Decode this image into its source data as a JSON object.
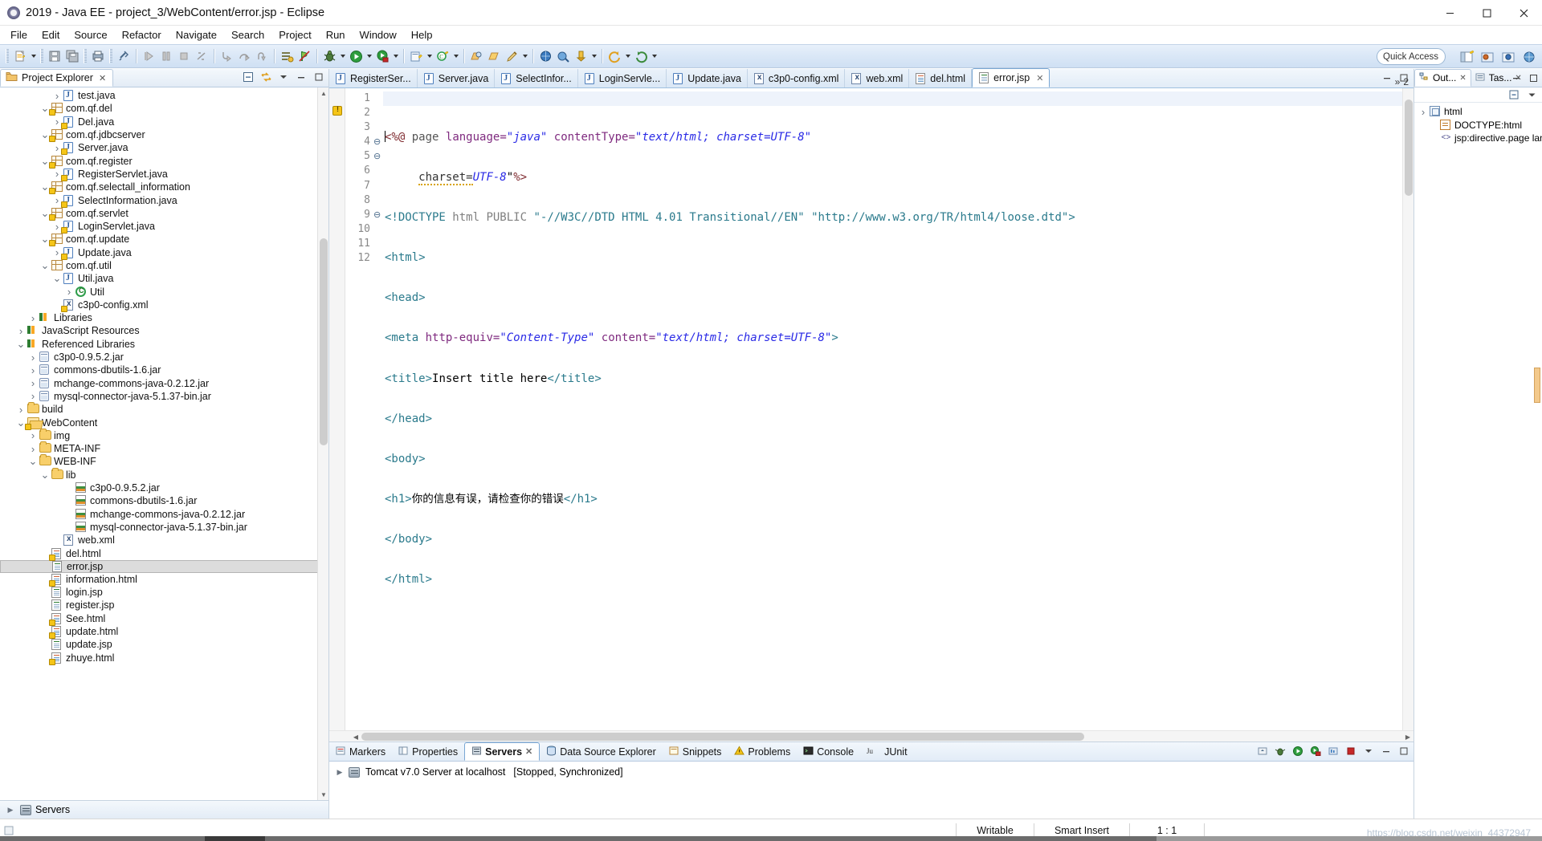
{
  "window": {
    "title": "2019 - Java EE - project_3/WebContent/error.jsp - Eclipse",
    "app_icon": "eclipse-icon",
    "minimize": "minimize-button",
    "maximize": "maximize-button",
    "close": "close-button"
  },
  "menubar": {
    "items": [
      "File",
      "Edit",
      "Source",
      "Refactor",
      "Navigate",
      "Search",
      "Project",
      "Run",
      "Window",
      "Help"
    ]
  },
  "toolbar": {
    "quick_access_placeholder": "Quick Access",
    "icons": [
      "new-wizard-icon",
      "save-icon",
      "save-all-icon",
      "print-icon",
      "link-icon",
      "resume-icon",
      "suspend-icon",
      "terminate-icon",
      "step-icon",
      "step-into-icon",
      "step-over-icon",
      "step-return-icon",
      "open-task-icon",
      "skip-breakpoints-icon",
      "debug-icon",
      "run-icon",
      "run-server-icon",
      "new-java-project-icon",
      "new-class-icon",
      "new-annotation-icon",
      "open-type-icon",
      "search-icon",
      "next-annotation-icon",
      "previous-annotation-icon",
      "last-edit-icon",
      "back-icon",
      "forward-icon"
    ],
    "perspective_icons": [
      "open-perspective-icon",
      "java-ee-perspective-icon",
      "java-perspective-icon",
      "web-perspective-icon"
    ]
  },
  "project_explorer": {
    "tab_label": "Project Explorer",
    "tab_icon": "project-explorer-icon",
    "actions": [
      "collapse-all-icon",
      "link-with-editor-icon",
      "view-menu-icon",
      "minimize-icon",
      "maximize-icon"
    ],
    "tree": [
      {
        "label": "test.java",
        "indent": 4,
        "icon": "java-file-icon",
        "twist": "collapsed",
        "warn": false
      },
      {
        "label": "com.qf.del",
        "indent": 3,
        "icon": "package-icon",
        "twist": "expanded",
        "warn": true
      },
      {
        "label": "Del.java",
        "indent": 4,
        "icon": "java-file-icon",
        "twist": "collapsed",
        "warn": true
      },
      {
        "label": "com.qf.jdbcserver",
        "indent": 3,
        "icon": "package-icon",
        "twist": "expanded",
        "warn": true
      },
      {
        "label": "Server.java",
        "indent": 4,
        "icon": "java-file-icon",
        "twist": "collapsed",
        "warn": true
      },
      {
        "label": "com.qf.register",
        "indent": 3,
        "icon": "package-icon",
        "twist": "expanded",
        "warn": true
      },
      {
        "label": "RegisterServlet.java",
        "indent": 4,
        "icon": "java-file-icon",
        "twist": "collapsed",
        "warn": true
      },
      {
        "label": "com.qf.selectall_information",
        "indent": 3,
        "icon": "package-icon",
        "twist": "expanded",
        "warn": true
      },
      {
        "label": "SelectInformation.java",
        "indent": 4,
        "icon": "java-file-icon",
        "twist": "collapsed",
        "warn": true
      },
      {
        "label": "com.qf.servlet",
        "indent": 3,
        "icon": "package-icon",
        "twist": "expanded",
        "warn": true
      },
      {
        "label": "LoginServlet.java",
        "indent": 4,
        "icon": "java-file-icon",
        "twist": "collapsed",
        "warn": true
      },
      {
        "label": "com.qf.update",
        "indent": 3,
        "icon": "package-icon",
        "twist": "expanded",
        "warn": true
      },
      {
        "label": "Update.java",
        "indent": 4,
        "icon": "java-file-icon",
        "twist": "collapsed",
        "warn": true
      },
      {
        "label": "com.qf.util",
        "indent": 3,
        "icon": "package-icon",
        "twist": "expanded",
        "warn": false
      },
      {
        "label": "Util.java",
        "indent": 4,
        "icon": "java-file-icon",
        "twist": "expanded",
        "warn": false
      },
      {
        "label": "Util",
        "indent": 5,
        "icon": "class-icon",
        "twist": "collapsed",
        "warn": false
      },
      {
        "label": "c3p0-config.xml",
        "indent": 4,
        "icon": "xml-file-icon",
        "twist": "none",
        "warn": true
      },
      {
        "label": "Libraries",
        "indent": 2,
        "icon": "library-icon",
        "twist": "collapsed",
        "warn": false
      },
      {
        "label": "JavaScript Resources",
        "indent": 1,
        "icon": "library-icon",
        "twist": "collapsed",
        "warn": false
      },
      {
        "label": "Referenced Libraries",
        "indent": 1,
        "icon": "library-icon",
        "twist": "expanded",
        "warn": false
      },
      {
        "label": "c3p0-0.9.5.2.jar",
        "indent": 2,
        "icon": "jar-icon",
        "twist": "collapsed",
        "warn": false
      },
      {
        "label": "commons-dbutils-1.6.jar",
        "indent": 2,
        "icon": "jar-icon",
        "twist": "collapsed",
        "warn": false
      },
      {
        "label": "mchange-commons-java-0.2.12.jar",
        "indent": 2,
        "icon": "jar-icon",
        "twist": "collapsed",
        "warn": false
      },
      {
        "label": "mysql-connector-java-5.1.37-bin.jar",
        "indent": 2,
        "icon": "jar-icon",
        "twist": "collapsed",
        "warn": false
      },
      {
        "label": "build",
        "indent": 1,
        "icon": "folder-icon",
        "twist": "collapsed",
        "warn": false
      },
      {
        "label": "WebContent",
        "indent": 1,
        "icon": "folder-open-icon",
        "twist": "expanded",
        "warn": true
      },
      {
        "label": "img",
        "indent": 2,
        "icon": "folder-icon",
        "twist": "collapsed",
        "warn": false
      },
      {
        "label": "META-INF",
        "indent": 2,
        "icon": "folder-icon",
        "twist": "collapsed",
        "warn": false
      },
      {
        "label": "WEB-INF",
        "indent": 2,
        "icon": "folder-icon",
        "twist": "expanded",
        "warn": false
      },
      {
        "label": "lib",
        "indent": 3,
        "icon": "folder-icon",
        "twist": "expanded",
        "warn": false
      },
      {
        "label": "c3p0-0.9.5.2.jar",
        "indent": 5,
        "icon": "jar-archive-icon",
        "twist": "none",
        "warn": false
      },
      {
        "label": "commons-dbutils-1.6.jar",
        "indent": 5,
        "icon": "jar-archive-icon",
        "twist": "none",
        "warn": false
      },
      {
        "label": "mchange-commons-java-0.2.12.jar",
        "indent": 5,
        "icon": "jar-archive-icon",
        "twist": "none",
        "warn": false
      },
      {
        "label": "mysql-connector-java-5.1.37-bin.jar",
        "indent": 5,
        "icon": "jar-archive-icon",
        "twist": "none",
        "warn": false
      },
      {
        "label": "web.xml",
        "indent": 4,
        "icon": "xml-file-icon",
        "twist": "none",
        "warn": false
      },
      {
        "label": "del.html",
        "indent": 3,
        "icon": "html-file-icon",
        "twist": "none",
        "warn": true
      },
      {
        "label": "error.jsp",
        "indent": 3,
        "icon": "jsp-file-icon",
        "twist": "none",
        "warn": false,
        "selected": true
      },
      {
        "label": "information.html",
        "indent": 3,
        "icon": "html-file-icon",
        "twist": "none",
        "warn": true
      },
      {
        "label": "login.jsp",
        "indent": 3,
        "icon": "jsp-file-icon",
        "twist": "none",
        "warn": false
      },
      {
        "label": "register.jsp",
        "indent": 3,
        "icon": "jsp-file-icon",
        "twist": "none",
        "warn": false
      },
      {
        "label": "See.html",
        "indent": 3,
        "icon": "html-file-icon",
        "twist": "none",
        "warn": true
      },
      {
        "label": "update.html",
        "indent": 3,
        "icon": "html-file-icon",
        "twist": "none",
        "warn": true
      },
      {
        "label": "update.jsp",
        "indent": 3,
        "icon": "jsp-file-icon",
        "twist": "none",
        "warn": false
      },
      {
        "label": "zhuye.html",
        "indent": 3,
        "icon": "html-file-icon",
        "twist": "none",
        "warn": true
      }
    ],
    "bottom_node": {
      "label": "Servers",
      "icon": "servers-icon",
      "twist": "collapsed"
    }
  },
  "editor": {
    "tabs": [
      {
        "label": "RegisterSer...",
        "icon": "java-file-icon",
        "active": false,
        "closable": false
      },
      {
        "label": "Server.java",
        "icon": "java-file-icon",
        "active": false,
        "closable": false
      },
      {
        "label": "SelectInfor...",
        "icon": "java-file-icon",
        "active": false,
        "closable": false
      },
      {
        "label": "LoginServle...",
        "icon": "java-file-icon",
        "active": false,
        "closable": false
      },
      {
        "label": "Update.java",
        "icon": "java-file-icon",
        "active": false,
        "closable": false
      },
      {
        "label": "c3p0-config.xml",
        "icon": "xml-file-icon",
        "active": false,
        "closable": false
      },
      {
        "label": "web.xml",
        "icon": "xml-file-icon",
        "active": false,
        "closable": false
      },
      {
        "label": "del.html",
        "icon": "html-file-icon",
        "active": false,
        "closable": false
      },
      {
        "label": "error.jsp",
        "icon": "jsp-file-icon",
        "active": true,
        "closable": true
      }
    ],
    "overflow_label": "»",
    "overflow_count": "2",
    "controls": [
      "minimize-icon",
      "maximize-icon"
    ],
    "lines": [
      {
        "no": "1",
        "fold": "",
        "warn": false
      },
      {
        "no": "2",
        "fold": "",
        "warn": true
      },
      {
        "no": "3",
        "fold": "",
        "warn": false
      },
      {
        "no": "4",
        "fold": "⊖",
        "warn": false
      },
      {
        "no": "5",
        "fold": "⊖",
        "warn": false
      },
      {
        "no": "6",
        "fold": "",
        "warn": false
      },
      {
        "no": "7",
        "fold": "",
        "warn": false
      },
      {
        "no": "8",
        "fold": "",
        "warn": false
      },
      {
        "no": "9",
        "fold": "⊖",
        "warn": false
      },
      {
        "no": "10",
        "fold": "",
        "warn": false
      },
      {
        "no": "11",
        "fold": "",
        "warn": false
      },
      {
        "no": "12",
        "fold": "",
        "warn": false
      }
    ],
    "source_text": [
      "<%@ page language=\"java\" contentType=\"text/html; charset=UTF-8\"",
      "    charset=UTF-8\"%>",
      "<!DOCTYPE html PUBLIC \"-//W3C//DTD HTML 4.01 Transitional//EN\" \"http://www.w3.org/TR/html4/loose.dtd\">",
      "<html>",
      "<head>",
      "<meta http-equiv=\"Content-Type\" content=\"text/html; charset=UTF-8\">",
      "<title>Insert title here</title>",
      "</head>",
      "<body>",
      "<h1>你的信息有误，请检查你的错误</h1>",
      "</body>",
      "</html>"
    ]
  },
  "bottom_view": {
    "tabs": [
      {
        "label": "Markers",
        "icon": "markers-icon",
        "active": false
      },
      {
        "label": "Properties",
        "icon": "properties-icon",
        "active": false
      },
      {
        "label": "Servers",
        "icon": "servers-icon",
        "active": true
      },
      {
        "label": "Data Source Explorer",
        "icon": "data-source-icon",
        "active": false
      },
      {
        "label": "Snippets",
        "icon": "snippets-icon",
        "active": false
      },
      {
        "label": "Problems",
        "icon": "problems-icon",
        "active": false
      },
      {
        "label": "Console",
        "icon": "console-icon",
        "active": false
      },
      {
        "label": "JUnit",
        "icon": "junit-icon",
        "active": false
      }
    ],
    "controls": [
      "start-server-icon",
      "debug-server-icon",
      "run-server-icon",
      "profile-server-icon",
      "stop-server-icon",
      "publish-icon",
      "view-menu-icon",
      "minimize-icon",
      "maximize-icon"
    ],
    "server_row": {
      "twist": "collapsed",
      "icon": "tomcat-server-icon",
      "name": "Tomcat v7.0 Server at localhost",
      "status": "[Stopped, Synchronized]"
    }
  },
  "outline": {
    "tabs": [
      {
        "label": "Out...",
        "icon": "outline-icon",
        "active": true,
        "closable": true
      },
      {
        "label": "Tas...",
        "icon": "tasks-icon",
        "active": false,
        "closable": true
      }
    ],
    "controls": [
      "collapse-all-icon",
      "view-menu-icon",
      "minimize-icon",
      "maximize-icon"
    ],
    "nodes": [
      {
        "label": "jsp:directive.page languag",
        "icon": "jsp-directive-icon",
        "indent": 1,
        "twist": "none"
      },
      {
        "label": "DOCTYPE:html",
        "icon": "doctype-icon",
        "indent": 1,
        "twist": "none"
      },
      {
        "label": "html",
        "icon": "html-node-icon",
        "indent": 0,
        "twist": "collapsed"
      }
    ]
  },
  "statusbar": {
    "writable": "Writable",
    "insert_mode": "Smart Insert",
    "position": "1 : 1",
    "watermark": "https://blog.csdn.net/weixin_44372947"
  }
}
